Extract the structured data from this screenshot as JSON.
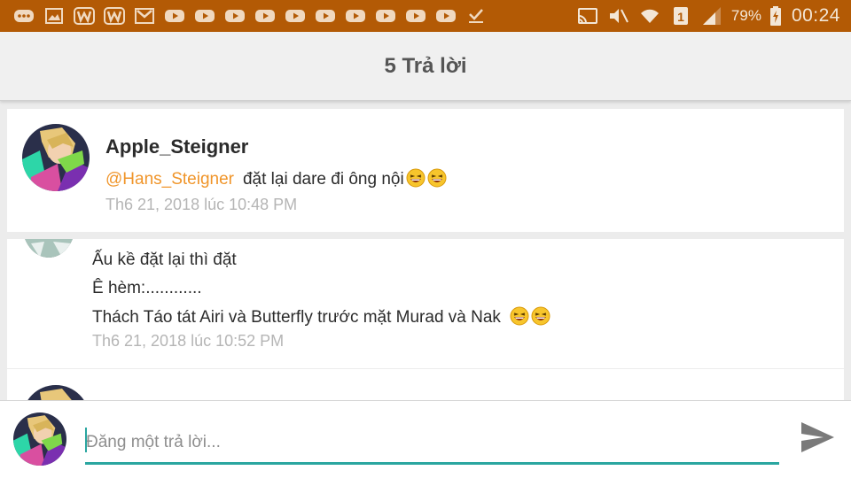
{
  "status_bar": {
    "notification_icons": [
      "message-icon",
      "gallery-icon",
      "wattpad-icon",
      "wattpad-icon",
      "gmail-icon",
      "youtube-icon",
      "youtube-icon",
      "youtube-icon",
      "youtube-icon",
      "youtube-icon",
      "youtube-icon",
      "youtube-icon",
      "youtube-icon",
      "youtube-icon",
      "youtube-icon",
      "youtube-icon",
      "download-done-icon"
    ],
    "battery_percent": "79%",
    "time": "00:24",
    "sim_label": "1"
  },
  "header": {
    "title": "5 Trả lời"
  },
  "comments": [
    {
      "author": "Apple_Steigner",
      "mention": "@Hans_Steigner",
      "text": "đặt lại dare đi ông nội",
      "timestamp": "Th6 21, 2018 lúc 10:48 PM"
    },
    {
      "lines": [
        "Ấu kề đặt lại thì đặt",
        "Ê hèm:............",
        "Thách Táo tát Airi và Butterfly trước mặt Murad và Nak"
      ],
      "timestamp": "Th6 21, 2018 lúc 10:52 PM"
    }
  ],
  "composer": {
    "placeholder": "Đăng một trả lời..."
  },
  "colors": {
    "status_bar": "#b35a05",
    "mention": "#f0952a",
    "accent": "#2aa6a0"
  }
}
